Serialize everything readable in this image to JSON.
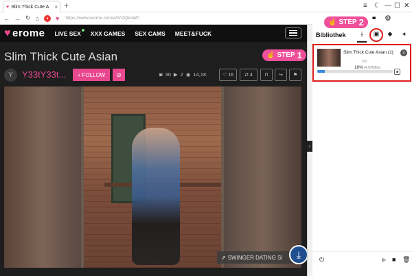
{
  "browser": {
    "tab_title": "Slim Thick Cute A",
    "url": "https://www.erome.com/a/lVOQkoWC"
  },
  "site": {
    "logo_text": "erome",
    "nav": [
      "LIVE SEX",
      "XXX GAMES",
      "SEX CAMS",
      "MEET&FUCK"
    ],
    "album_title": "Slim Thick Cute Asian",
    "avatar_letter": "Y",
    "username": "Y33tY33t...",
    "follow_label": "FOLLOW",
    "stats": {
      "images": "30",
      "videos": "2",
      "views": "14,1K"
    },
    "likes": "16",
    "reposts": "4",
    "banner": "SWINGER DATING SI"
  },
  "steps": {
    "step1": {
      "word": "STEP",
      "num": "1"
    },
    "step2": {
      "word": "STEP",
      "num": "2"
    }
  },
  "panel": {
    "title": "Bibliothek",
    "download": {
      "name": "Slim Thick Cute Asian (1)",
      "resolution": "720",
      "percent": "10%",
      "size": "(4.97MB/s)",
      "progress": 0.1
    }
  },
  "colors": {
    "accent": "#e8488e",
    "highlight": "#e01a1a",
    "progress": "#3a8ae0"
  }
}
